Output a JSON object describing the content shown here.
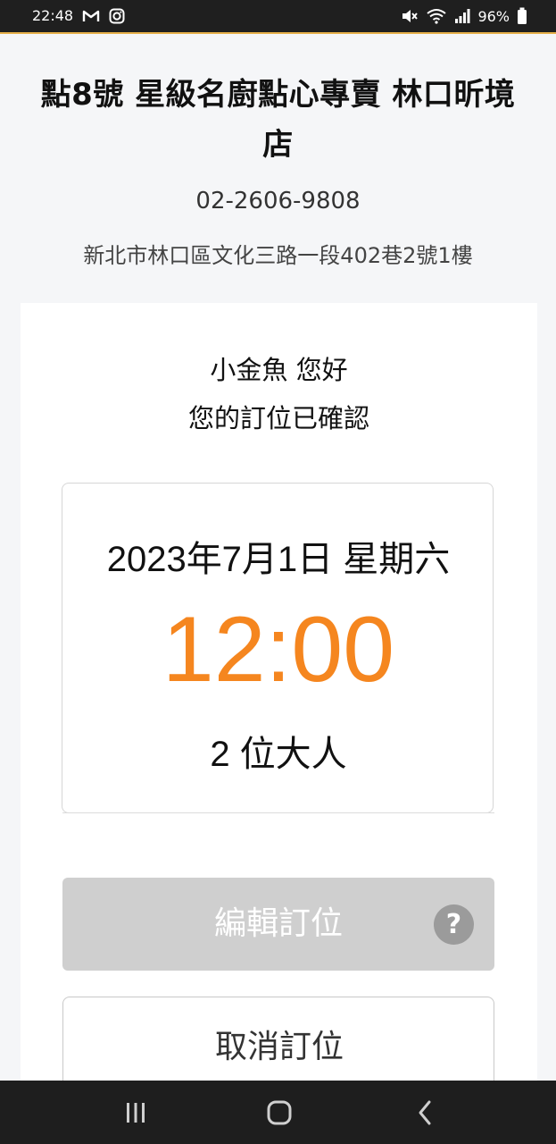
{
  "status_bar": {
    "time": "22:48",
    "battery": "96%",
    "left_icons": [
      "gmail-icon",
      "instagram-icon"
    ],
    "right_icons": [
      "mute-icon",
      "wifi-icon",
      "signal-icon",
      "battery-icon"
    ]
  },
  "restaurant": {
    "name": "點8號 星級名廚點心專賣 林口昕境店",
    "phone": "02-2606-9808",
    "address": "新北市林口區文化三路一段402巷2號1樓"
  },
  "greeting": {
    "line1": "小金魚 您好",
    "line2": "您的訂位已確認"
  },
  "reservation": {
    "date": "2023年7月1日 星期六",
    "time": "12:00",
    "party": "2 位大人"
  },
  "actions": {
    "edit_label": "編輯訂位",
    "help_symbol": "?",
    "cancel_label": "取消訂位"
  },
  "colors": {
    "accent": "#f5861f",
    "disabled_button": "#cfcfcf",
    "status_bar": "#1f1f1f"
  },
  "nav_bar": {
    "icons": [
      "recent-apps-icon",
      "home-icon",
      "back-icon"
    ]
  }
}
